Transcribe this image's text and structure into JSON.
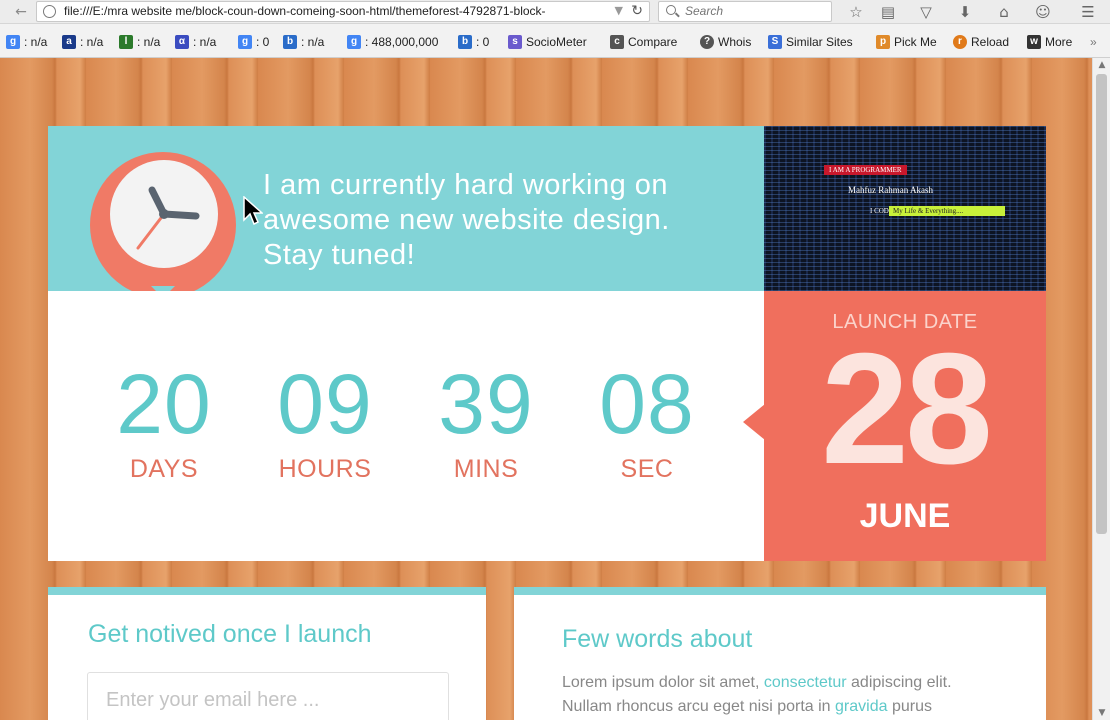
{
  "browser": {
    "url": "file:///E:/mra website me/block-coun-down-comeing-soon-html/themeforest-4792871-block-",
    "search_placeholder": "Search",
    "bookmarks": [
      {
        "label": ": n/a",
        "icon": "google-icon",
        "color": "#4285f4"
      },
      {
        "label": ": n/a",
        "icon": "alexa-icon",
        "color": "#1a3a8a"
      },
      {
        "label": ": n/a",
        "icon": "pagerank-icon",
        "color": "#2b7a2b"
      },
      {
        "label": ": n/a",
        "icon": "alpha-icon",
        "color": "#3b4cc0"
      },
      {
        "label": ": 0",
        "icon": "google-plus-icon",
        "color": "#4285f4"
      },
      {
        "label": ": n/a",
        "icon": "bing-icon",
        "color": "#2a6cc9"
      },
      {
        "label": ": 488,000,000",
        "icon": "google-index-icon",
        "color": "#4285f4"
      },
      {
        "label": ": 0",
        "icon": "bing-index-icon",
        "color": "#2a6cc9"
      },
      {
        "label": "SocioMeter",
        "icon": "sociometer-icon",
        "color": "#6a5acd"
      },
      {
        "label": "Compare",
        "icon": "compare-icon",
        "color": "#555"
      },
      {
        "label": "Whois",
        "icon": "whois-icon",
        "color": "#555"
      },
      {
        "label": "Similar Sites",
        "icon": "similar-sites-icon",
        "color": "#3a6fd8"
      },
      {
        "label": "Pick Me",
        "icon": "pick-me-icon",
        "color": "#e08a2a"
      },
      {
        "label": "Reload",
        "icon": "reload-icon",
        "color": "#e07a1a"
      },
      {
        "label": "More",
        "icon": "more-icon",
        "color": "#333"
      }
    ]
  },
  "hero": {
    "message": "I am currently hard working on awesome new website design. Stay tuned!"
  },
  "photo": {
    "tag1": "I AM A PROGRAMMER",
    "tag2": "Mahfuz Rahman Akash",
    "tag3": "I CODE",
    "tag4": "My Life & Everything...."
  },
  "countdown": [
    {
      "value": "20",
      "label": "DAYS"
    },
    {
      "value": "09",
      "label": "HOURS"
    },
    {
      "value": "39",
      "label": "MINS"
    },
    {
      "value": "08",
      "label": "SEC"
    }
  ],
  "launch": {
    "label": "LAUNCH DATE",
    "day": "28",
    "month": "JUNE"
  },
  "subscribe": {
    "title": "Get notived once I launch",
    "email_placeholder": "Enter your email here ..."
  },
  "about": {
    "title": "Few words about",
    "text_part1": "Lorem ipsum dolor sit amet, ",
    "link1": "consectetur",
    "text_part2": " adipiscing elit. Nullam rhoncus arcu eget nisi porta in ",
    "link2": "gravida",
    "text_part3": " purus imperdiet. Pellentesque et arcu ligula, vitae vulputae"
  },
  "colors": {
    "teal": "#82d4d7",
    "teal_text": "#5ec9c9",
    "coral": "#f06f5d"
  }
}
